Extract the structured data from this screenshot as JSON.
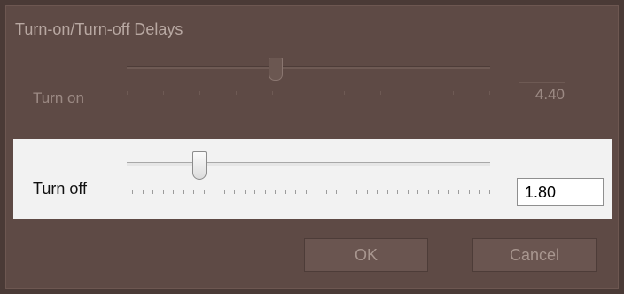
{
  "window": {
    "title": "Turn-on/Turn-off Delays"
  },
  "turn_on": {
    "label": "Turn on",
    "value": "4.40",
    "slider_fraction": 0.42
  },
  "turn_off": {
    "label": "Turn off",
    "value": "1.80",
    "slider_fraction": 0.19
  },
  "buttons": {
    "ok_label": "OK",
    "cancel_label": "Cancel"
  }
}
